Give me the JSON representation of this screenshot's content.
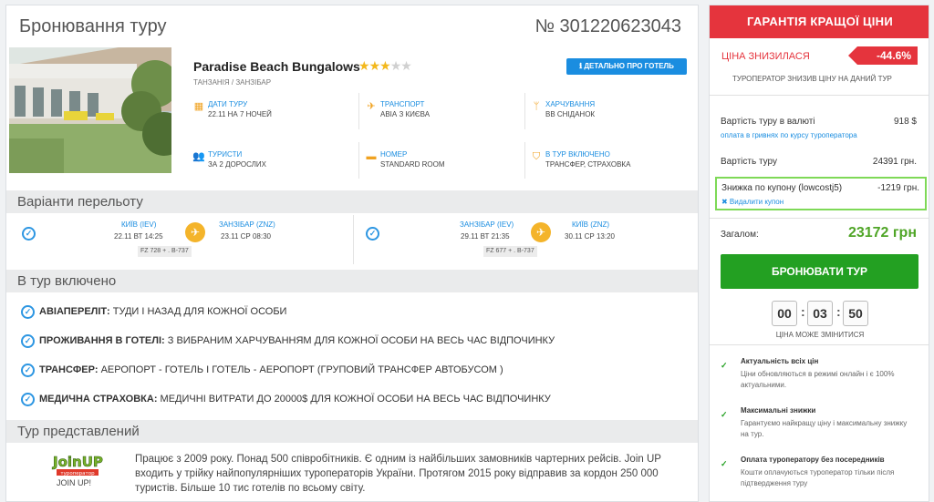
{
  "header": {
    "title": "Бронювання туру",
    "number": "№ 301220623043"
  },
  "hotel": {
    "name": "Paradise Beach Bungalows",
    "stars_filled": 3,
    "stars_total": 5,
    "location": "ТАНЗАНІЯ / ЗАНЗІБАР",
    "details_button": "ДЕТАЛЬНО ПРО ГОТЕЛЬ"
  },
  "info": {
    "dates": {
      "label": "ДАТИ ТУРУ",
      "value": "22.11 НА 7 НОЧЕЙ"
    },
    "transport": {
      "label": "ТРАНСПОРТ",
      "value": "АВІА З КИЄВА"
    },
    "meals": {
      "label": "ХАРЧУВАННЯ",
      "value": "BB СНІДАНОК"
    },
    "tourists": {
      "label": "ТУРИСТИ",
      "value": "ЗА 2 ДОРОСЛИХ"
    },
    "room": {
      "label": "НОМЕР",
      "value": "STANDARD ROOM"
    },
    "included": {
      "label": "В ТУР ВКЛЮЧЕНО",
      "value": "ТРАНСФЕР, СТРАХОВКА"
    }
  },
  "flights": {
    "title": "Варіанти перельоту",
    "outbound": {
      "from_city": "КИЇВ (IEV)",
      "from_date": "22.11 ВТ 14:25",
      "to_city": "ЗАНЗІБАР (ZNZ)",
      "to_date": "23.11 СР 08:30",
      "code": "FZ 728 + . B-737"
    },
    "return": {
      "from_city": "ЗАНЗІБАР (IEV)",
      "from_date": "29.11 ВТ 21:35",
      "to_city": "КИЇВ (ZNZ)",
      "to_date": "30.11 СР 13:20",
      "code": "FZ 677 + . B-737"
    }
  },
  "included": {
    "title": "В тур включено",
    "items": [
      {
        "head": "АВІАПЕРЕЛІТ:",
        "text": " ТУДИ І НАЗАД ДЛЯ КОЖНОЇ ОСОБИ"
      },
      {
        "head": "ПРОЖИВАННЯ В ГОТЕЛІ:",
        "text": " З ВИБРАНИМ ХАРЧУВАННЯМ ДЛЯ КОЖНОЇ ОСОБИ НА ВЕСЬ ЧАС ВІДПОЧИНКУ"
      },
      {
        "head": "ТРАНСФЕР:",
        "text": " АЕРОПОРТ - ГОТЕЛЬ І ГОТЕЛЬ - АЕРОПОРТ (ГРУПОВИЙ ТРАНСФЕР АВТОБУСОМ )"
      },
      {
        "head": "МЕДИЧНА СТРАХОВКА:",
        "text": " МЕДИЧНІ ВИТРАТИ ДО 20000$ ДЛЯ КОЖНОЇ ОСОБИ НА ВЕСЬ ЧАС ВІДПОЧИНКУ"
      }
    ]
  },
  "operator": {
    "title": "Тур представлений",
    "logo_text": "JoinUP!",
    "logo_sub": "туроператор",
    "name": "JOIN UP!",
    "description": "Працює з 2009 року. Понад 500 співробітників. Є одним із найбільших замовників чартерних рейсів. Join UP входить у трійку найпопулярніших туроператорів України. Протягом 2015 року відправив за кордон 250 000 туристів. Більше 10 тис готелів по всьому світу."
  },
  "sidebar": {
    "guarantee": "ГАРАНТІЯ КРАЩОЇ ЦІНИ",
    "price_drop": "ЦІНА ЗНИЗИЛАСЯ",
    "drop_badge": "-44.6%",
    "drop_sub": "ТУРОПЕРАТОР ЗНИЗИВ ЦІНУ НА ДАНИЙ ТУР",
    "cost_currency_label": "Вартість туру в валюті",
    "cost_currency_value": "918 $",
    "uah_link": "оплата в гривнях по курсу туроператора",
    "cost_label": "Вартість туру",
    "cost_value": "24391 грн.",
    "coupon_label": "Знижка по купону (lowcostj5)",
    "coupon_value": "-1219 грн.",
    "coupon_remove": "✖ Видалити купон",
    "total_label": "Загалом:",
    "total_value": "23172 грн",
    "book_button": "БРОНЮВАТИ ТУР",
    "timer": {
      "h": "00",
      "m": "03",
      "s": "50"
    },
    "timer_sub": "ЦІНА МОЖЕ ЗМІНИТИСЯ",
    "features": [
      {
        "title": "Актуальність всіх цін",
        "desc": "Ціни обновляються в режимі онлайн і є 100% актуальними."
      },
      {
        "title": "Максимальні знижки",
        "desc": "Гарантуємо найкращу ціну і максимальну знижку на тур."
      },
      {
        "title": "Оплата туроператору без посередників",
        "desc": "Кошти оплачуються туроператор тільки після підтвердження туру"
      }
    ]
  },
  "colors": {
    "accent_blue": "#1a8de0",
    "guarantee_red": "#e5343d",
    "book_green": "#23a022",
    "icon_orange": "#f0a220",
    "highlight_green": "#7ed957"
  }
}
